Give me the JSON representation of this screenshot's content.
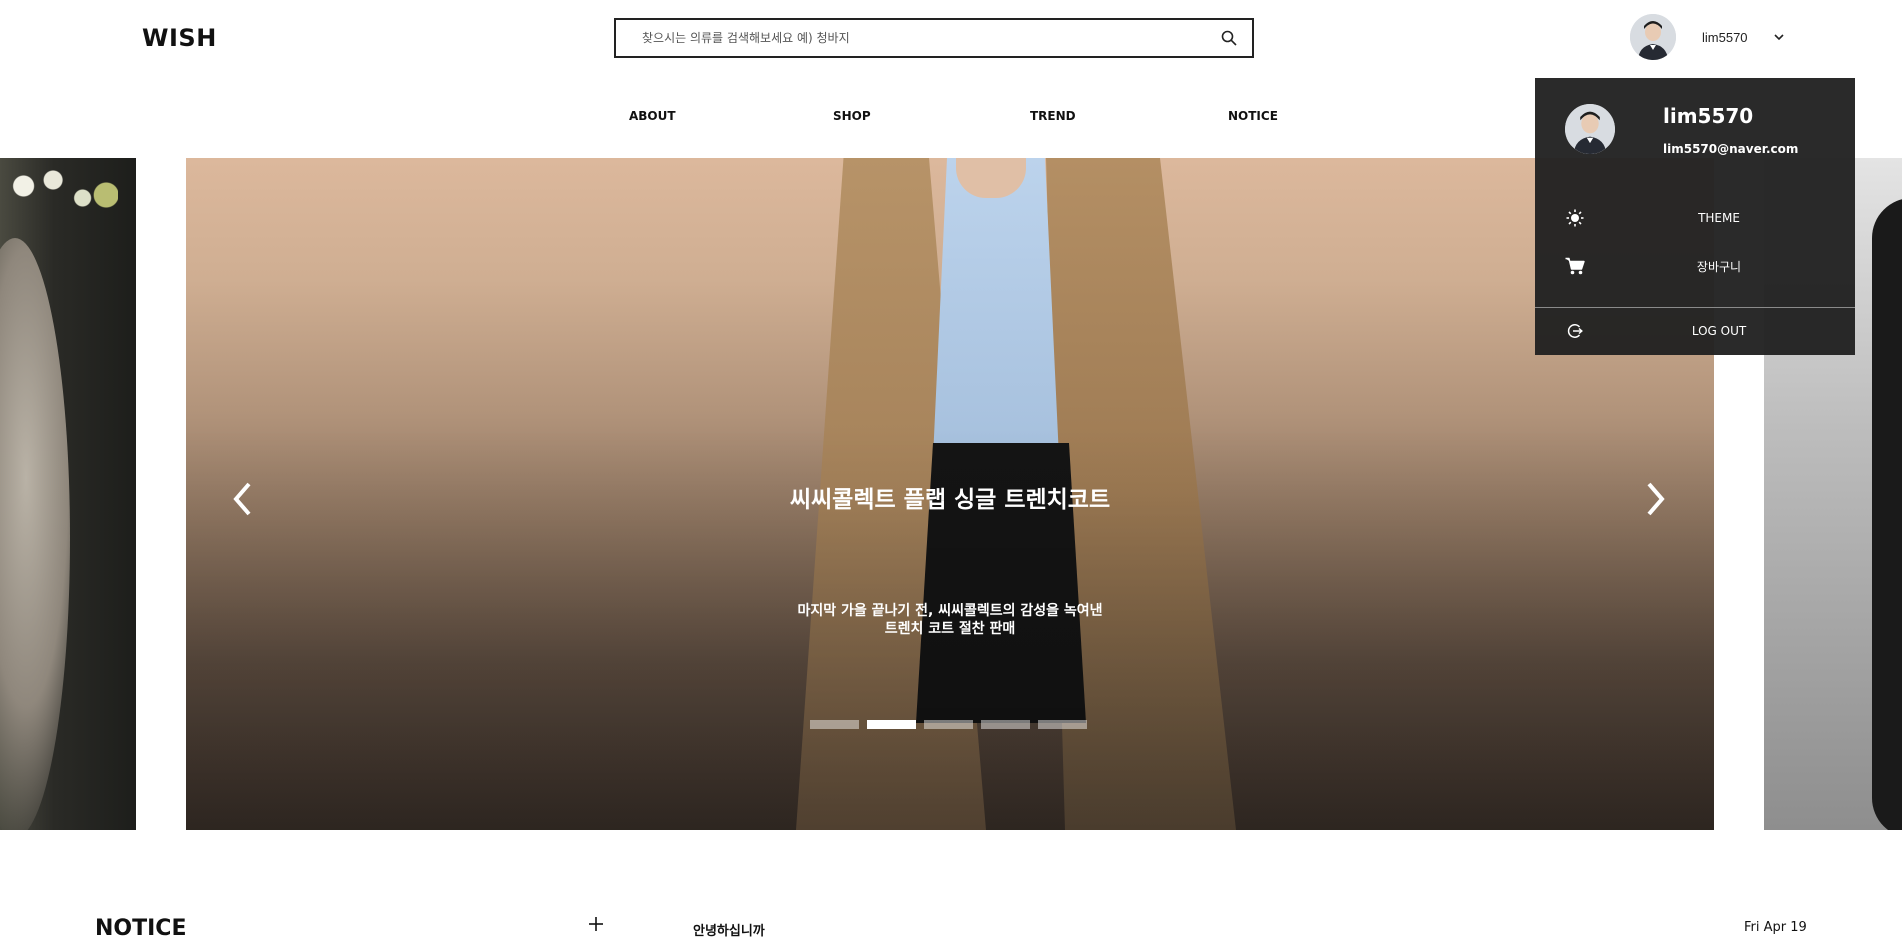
{
  "header": {
    "logo": "WISH",
    "search_placeholder": "찾으시는 의류를 검색해보세요 예) 청바지",
    "username": "lim5570"
  },
  "nav": {
    "items": [
      "ABOUT",
      "SHOP",
      "TREND",
      "NOTICE"
    ]
  },
  "hero": {
    "title": "씨씨콜렉트 플랩 싱글 트렌치코트",
    "subtitle_line1": "마지막 가을 끝나기 전, 씨씨콜렉트의 감성을 녹여낸",
    "subtitle_line2": "트렌치 코트 절찬 판매",
    "slide_count": 5,
    "active_slide": 2
  },
  "notice": {
    "title": "NOTICE",
    "item_title": "안녕하십니까",
    "item_date": "Fri Apr 19"
  },
  "dropdown": {
    "name": "lim5570",
    "email": "lim5570@naver.com",
    "theme_label": "THEME",
    "cart_label": "장바구니",
    "logout_label": "LOG OUT"
  },
  "icons": {
    "search": "search-icon",
    "chevron": "chevron-down-icon",
    "theme": "sun-icon",
    "cart": "cart-icon",
    "logout": "logout-icon",
    "prev": "chevron-left-icon",
    "next": "chevron-right-icon",
    "plus": "plus-icon"
  },
  "colors": {
    "dropdown_bg": "#212121",
    "active_dot": "#ffffff",
    "text": "#111111"
  }
}
